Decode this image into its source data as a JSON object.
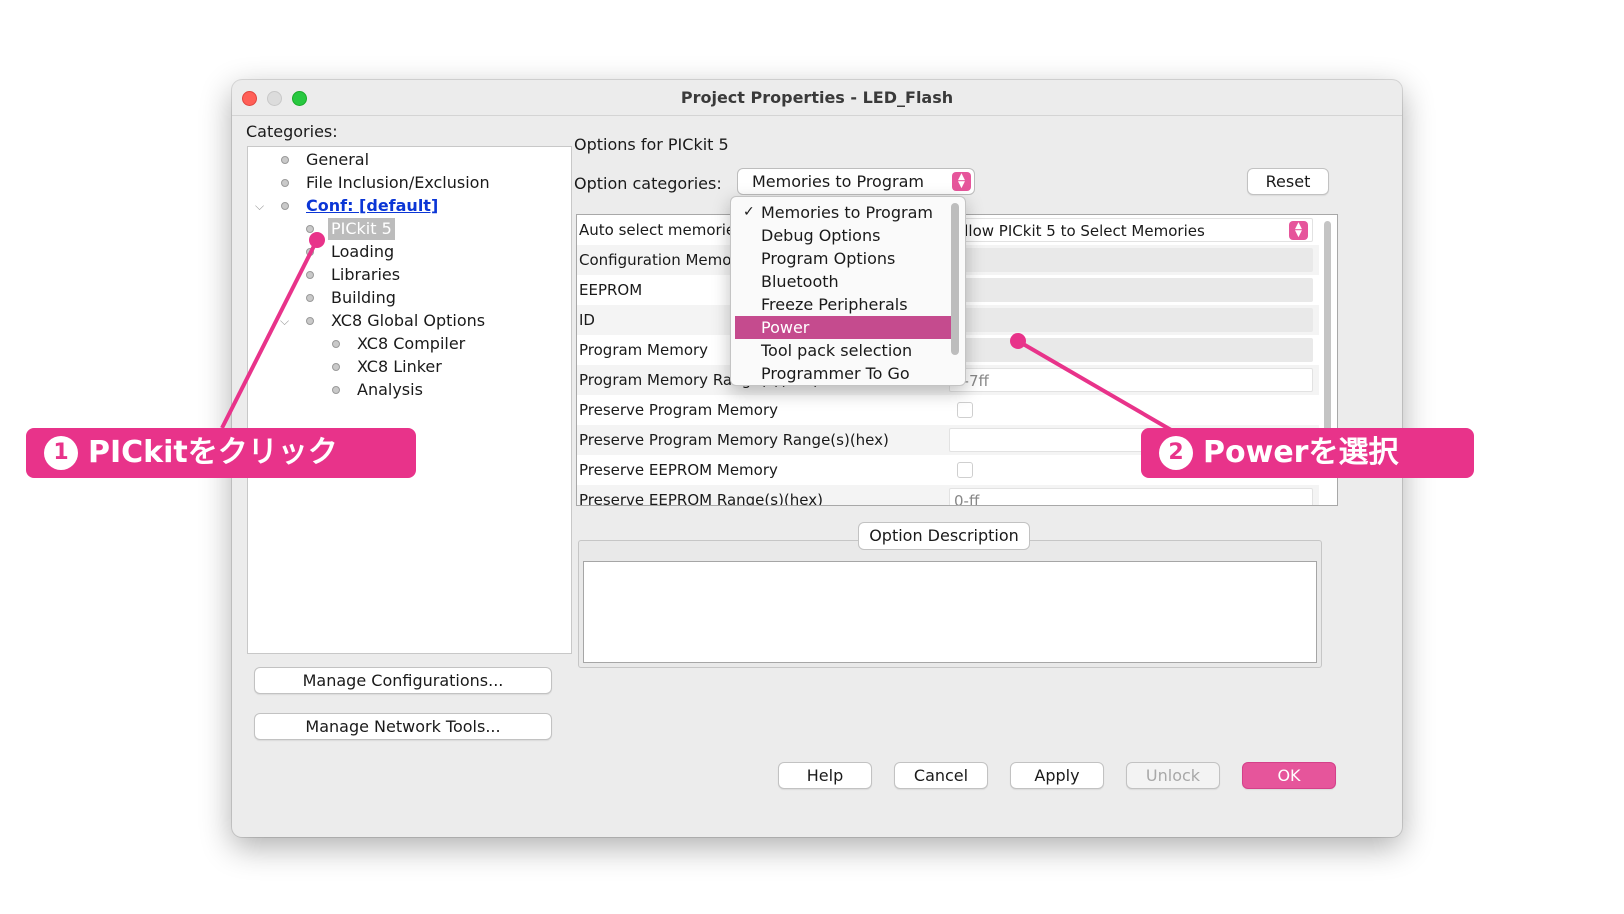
{
  "window": {
    "title": "Project Properties - LED_Flash"
  },
  "categories": {
    "label": "Categories:",
    "items": [
      {
        "label": "General"
      },
      {
        "label": "File Inclusion/Exclusion"
      },
      {
        "label": "Conf: [default]"
      },
      {
        "label": "PICkit 5"
      },
      {
        "label": "Loading"
      },
      {
        "label": "Libraries"
      },
      {
        "label": "Building"
      },
      {
        "label": "XC8 Global Options"
      },
      {
        "label": "XC8 Compiler"
      },
      {
        "label": "XC8 Linker"
      },
      {
        "label": "Analysis"
      }
    ],
    "manage_configurations": "Manage Configurations...",
    "manage_network_tools": "Manage Network Tools..."
  },
  "options": {
    "heading": "Options for PICkit 5",
    "categories_label": "Option categories:",
    "selected_category": "Memories to Program",
    "reset": "Reset",
    "table_rows": [
      {
        "name": "Auto select memories a",
        "value": "Allow PICkit 5 to Select Memories"
      },
      {
        "name": "Configuration Memory",
        "value": ""
      },
      {
        "name": "EEPROM",
        "value": ""
      },
      {
        "name": "ID",
        "value": ""
      },
      {
        "name": "Program Memory",
        "value": ""
      },
      {
        "name": "Program Memory Range(s)(hex)",
        "value": "0-7ff"
      },
      {
        "name": "Preserve Program Memory",
        "value": ""
      },
      {
        "name": "Preserve Program Memory Range(s)(hex)",
        "value": ""
      },
      {
        "name": "Preserve EEPROM Memory",
        "value": ""
      },
      {
        "name": "Preserve EEPROM Range(s)(hex)",
        "value": "0-ff"
      }
    ],
    "description_label": "Option Description"
  },
  "dropdown": {
    "items": [
      {
        "label": "Memories to Program",
        "check": "✓"
      },
      {
        "label": "Debug Options",
        "check": ""
      },
      {
        "label": "Program Options",
        "check": ""
      },
      {
        "label": "Bluetooth",
        "check": ""
      },
      {
        "label": "Freeze Peripherals",
        "check": ""
      },
      {
        "label": "Power",
        "check": ""
      },
      {
        "label": "Tool pack selection",
        "check": ""
      },
      {
        "label": "Programmer To Go",
        "check": ""
      }
    ],
    "highlighted_index": 5
  },
  "buttons": {
    "help": "Help",
    "cancel": "Cancel",
    "apply": "Apply",
    "unlock": "Unlock",
    "ok": "OK"
  },
  "annotations": {
    "callout1": {
      "number": "1",
      "text": "PICkitをクリック"
    },
    "callout2": {
      "number": "2",
      "text": "Powerを選択"
    },
    "color": "#e8338a"
  },
  "colors": {
    "accent": "#e6559b",
    "highlight": "#c54b8e",
    "link": "#0b36d6"
  },
  "icons": {
    "combo": "up-down-chevron-icon",
    "tree_bullet": "tree-node-bullet-icon",
    "tree_expand": "chevron-down-icon"
  }
}
